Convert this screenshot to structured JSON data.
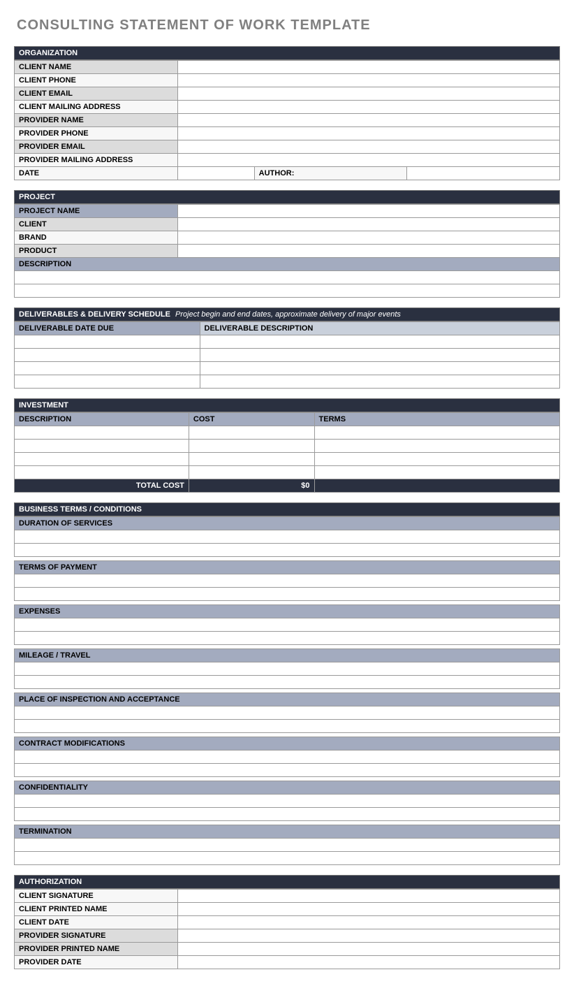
{
  "title": "CONSULTING STATEMENT OF WORK TEMPLATE",
  "organization": {
    "header": "ORGANIZATION",
    "rows": [
      {
        "label": "CLIENT NAME",
        "alt": true
      },
      {
        "label": "CLIENT  PHONE",
        "alt": false
      },
      {
        "label": "CLIENT EMAIL",
        "alt": true
      },
      {
        "label": "CLIENT MAILING ADDRESS",
        "alt": false
      },
      {
        "label": "PROVIDER NAME",
        "alt": true
      },
      {
        "label": "PROVIDER PHONE",
        "alt": false
      },
      {
        "label": "PROVIDER EMAIL",
        "alt": true
      },
      {
        "label": "PROVIDER MAILING ADDRESS",
        "alt": false
      }
    ],
    "date_label": "DATE",
    "author_label": "AUTHOR:"
  },
  "project": {
    "header": "PROJECT",
    "rows": [
      {
        "label": "PROJECT NAME",
        "style": "blue"
      },
      {
        "label": "CLIENT",
        "style": "alt"
      },
      {
        "label": "BRAND",
        "style": "plain"
      },
      {
        "label": "PRODUCT",
        "style": "alt"
      }
    ],
    "description_label": "DESCRIPTION"
  },
  "deliverables": {
    "header": "DELIVERABLES & DELIVERY SCHEDULE",
    "subtitle": "Project begin and end dates, approximate delivery of major events",
    "col1": "DELIVERABLE DATE DUE",
    "col2": "DELIVERABLE DESCRIPTION"
  },
  "investment": {
    "header": "INVESTMENT",
    "col1": "DESCRIPTION",
    "col2": "COST",
    "col3": "TERMS",
    "total_label": "TOTAL COST",
    "total_value": "$0"
  },
  "terms": {
    "header": "BUSINESS TERMS / CONDITIONS",
    "items": [
      "DURATION OF SERVICES",
      "TERMS OF PAYMENT",
      "EXPENSES",
      "MILEAGE / TRAVEL",
      "PLACE OF INSPECTION AND ACCEPTANCE",
      "CONTRACT MODIFICATIONS",
      "CONFIDENTIALITY",
      "TERMINATION"
    ]
  },
  "authorization": {
    "header": "AUTHORIZATION",
    "rows": [
      {
        "label": "CLIENT SIGNATURE",
        "alt": false
      },
      {
        "label": "CLIENT PRINTED NAME",
        "alt": false
      },
      {
        "label": "CLIENT DATE",
        "alt": false
      },
      {
        "label": "PROVIDER SIGNATURE",
        "alt": true
      },
      {
        "label": "PROVIDER PRINTED NAME",
        "alt": true
      },
      {
        "label": "PROVIDER DATE",
        "alt": false
      }
    ]
  }
}
